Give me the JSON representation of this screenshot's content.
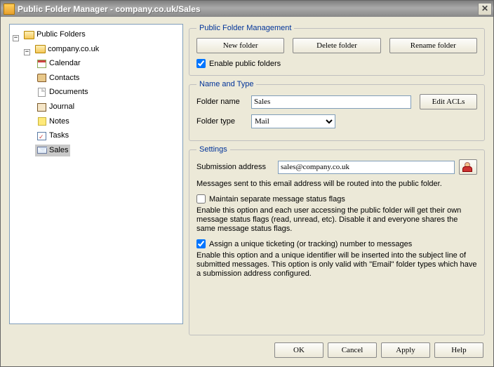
{
  "title": "Public Folder Manager - company.co.uk/Sales",
  "tree": {
    "root": "Public Folders",
    "domain": "company.co.uk",
    "items": [
      "Calendar",
      "Contacts",
      "Documents",
      "Journal",
      "Notes",
      "Tasks",
      "Sales"
    ]
  },
  "management": {
    "legend": "Public Folder Management",
    "new": "New folder",
    "delete": "Delete folder",
    "rename": "Rename folder",
    "enable": "Enable public folders"
  },
  "nameType": {
    "legend": "Name and Type",
    "name_lbl": "Folder name",
    "name_val": "Sales",
    "type_lbl": "Folder type",
    "type_val": "Mail",
    "acls": "Edit ACLs"
  },
  "settings": {
    "legend": "Settings",
    "sub_lbl": "Submission address",
    "sub_val": "sales@company.co.uk",
    "sub_hint": "Messages sent to this email address will be routed into the public folder.",
    "flags_lbl": "Maintain separate message status flags",
    "flags_hint": "Enable this option and each user accessing the public folder will get their own message status flags (read, unread, etc). Disable it and everyone shares the same message status flags.",
    "ticket_lbl": "Assign a unique ticketing (or tracking) number to messages",
    "ticket_hint": "Enable this option and a unique identifier will be inserted into the subject line of submitted messages.  This option is only valid with \"Email\" folder types which have a submission address configured."
  },
  "buttons": {
    "ok": "OK",
    "cancel": "Cancel",
    "apply": "Apply",
    "help": "Help"
  }
}
